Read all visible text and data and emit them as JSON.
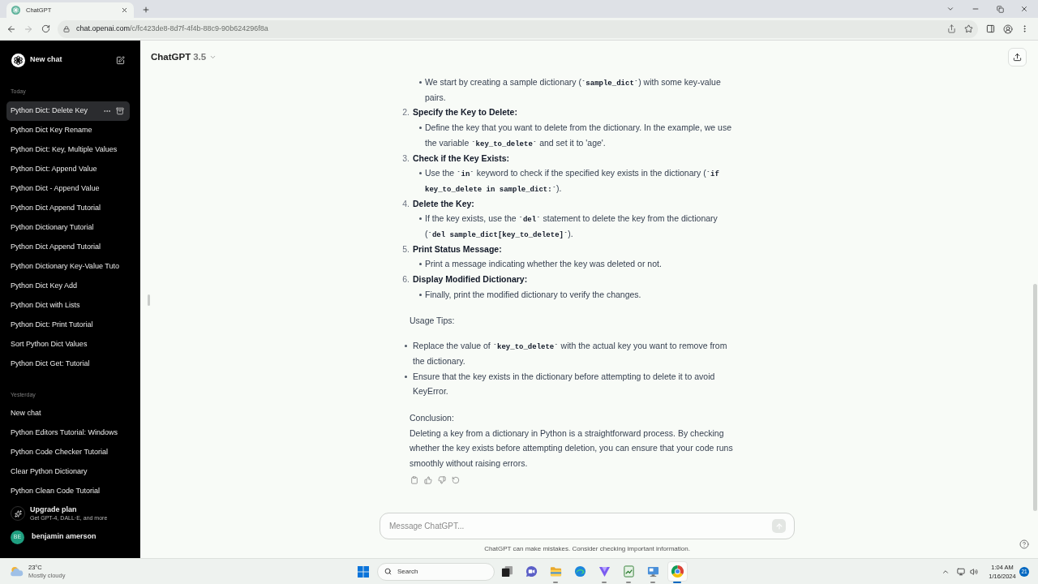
{
  "browser": {
    "tab_title": "ChatGPT",
    "url_host": "chat.openai.com",
    "url_path": "/c/fc423de8-8d7f-4f4b-88c9-90b624296f8a"
  },
  "sidebar": {
    "new_chat": "New chat",
    "groups": [
      {
        "label": "Today",
        "items": [
          {
            "title": "Python Dict: Delete Key",
            "selected": true
          },
          {
            "title": "Python Dict Key Rename",
            "selected": false
          },
          {
            "title": "Python Dict: Key, Multiple Values",
            "selected": false
          },
          {
            "title": "Python Dict: Append Value",
            "selected": false
          },
          {
            "title": "Python Dict - Append Value",
            "selected": false
          },
          {
            "title": "Python Dict Append Tutorial",
            "selected": false
          },
          {
            "title": "Python Dictionary Tutorial",
            "selected": false
          },
          {
            "title": "Python Dict Append Tutorial",
            "selected": false
          },
          {
            "title": "Python Dictionary Key-Value Tuto",
            "selected": false
          },
          {
            "title": "Python Dict Key Add",
            "selected": false
          },
          {
            "title": "Python Dict with Lists",
            "selected": false
          },
          {
            "title": "Python Dict: Print Tutorial",
            "selected": false
          },
          {
            "title": "Sort Python Dict Values",
            "selected": false
          },
          {
            "title": "Python Dict Get: Tutorial",
            "selected": false
          }
        ]
      },
      {
        "label": "Yesterday",
        "items": [
          {
            "title": "New chat",
            "selected": false
          },
          {
            "title": "Python Editors Tutorial: Windows",
            "selected": false
          },
          {
            "title": "Python Code Checker Tutorial",
            "selected": false
          },
          {
            "title": "Clear Python Dictionary",
            "selected": false
          },
          {
            "title": "Python Clean Code Tutorial",
            "selected": false
          }
        ]
      }
    ],
    "upgrade": {
      "title": "Upgrade plan",
      "subtitle": "Get GPT-4, DALL·E, and more"
    },
    "user": {
      "initials": "BE",
      "name": "benjamin amerson"
    }
  },
  "header": {
    "model": "ChatGPT",
    "version": "3.5"
  },
  "message": {
    "steps": [
      {
        "bullets": [
          [
            {
              "kind": "text",
              "text": "We start by creating a sample dictionary ("
            },
            {
              "kind": "code",
              "text": "`sample_dict`"
            },
            {
              "kind": "text",
              "text": ") with some key-value pairs."
            }
          ]
        ]
      },
      {
        "number": "2.",
        "heading": "Specify the Key to Delete:",
        "bullets": [
          [
            {
              "kind": "text",
              "text": "Define the key that you want to delete from the dictionary. In the example, we use the variable "
            },
            {
              "kind": "code",
              "text": "`key_to_delete`"
            },
            {
              "kind": "text",
              "text": " and set it to 'age'."
            }
          ]
        ]
      },
      {
        "number": "3.",
        "heading": "Check if the Key Exists:",
        "bullets": [
          [
            {
              "kind": "text",
              "text": "Use the "
            },
            {
              "kind": "code",
              "text": "`in`"
            },
            {
              "kind": "text",
              "text": " keyword to check if the specified key exists in the dictionary ("
            },
            {
              "kind": "code",
              "text": "`if key_to_delete in sample_dict:`"
            },
            {
              "kind": "text",
              "text": ")."
            }
          ]
        ]
      },
      {
        "number": "4.",
        "heading": "Delete the Key:",
        "bullets": [
          [
            {
              "kind": "text",
              "text": "If the key exists, use the "
            },
            {
              "kind": "code",
              "text": "`del`"
            },
            {
              "kind": "text",
              "text": " statement to delete the key from the dictionary ("
            },
            {
              "kind": "code",
              "text": "`del sample_dict[key_to_delete]`"
            },
            {
              "kind": "text",
              "text": ")."
            }
          ]
        ]
      },
      {
        "number": "5.",
        "heading": "Print Status Message:",
        "bullets": [
          [
            {
              "kind": "text",
              "text": "Print a message indicating whether the key was deleted or not."
            }
          ]
        ]
      },
      {
        "number": "6.",
        "heading": "Display Modified Dictionary:",
        "bullets": [
          [
            {
              "kind": "text",
              "text": "Finally, print the modified dictionary to verify the changes."
            }
          ]
        ]
      }
    ],
    "tips_heading": "Usage Tips:",
    "tips": [
      [
        {
          "kind": "text",
          "text": "Replace the value of "
        },
        {
          "kind": "code",
          "text": "`key_to_delete`"
        },
        {
          "kind": "text",
          "text": " with the actual key you want to remove from the dictionary."
        }
      ],
      [
        {
          "kind": "text",
          "text": "Ensure that the key exists in the dictionary before attempting to delete it to avoid KeyError."
        }
      ]
    ],
    "conclusion_heading": "Conclusion:",
    "conclusion": "Deleting a key from a dictionary in Python is a straightforward process. By checking whether the key exists before attempting deletion, you can ensure that your code runs smoothly without raising errors."
  },
  "composer": {
    "placeholder": "Message ChatGPT...",
    "send_disabled": true,
    "disclaimer": "ChatGPT can make mistakes. Consider checking important information."
  },
  "taskbar": {
    "weather": {
      "temperature": "23°C",
      "condition": "Mostly cloudy"
    },
    "search": "Search",
    "apps": [
      {
        "kind": "task-view",
        "running": false,
        "active": false
      },
      {
        "kind": "chat",
        "running": false,
        "active": false
      },
      {
        "kind": "folder",
        "running": true,
        "active": false
      },
      {
        "kind": "wave-browser",
        "running": false,
        "active": false
      },
      {
        "kind": "funnel",
        "running": true,
        "active": false
      },
      {
        "kind": "chart",
        "running": true,
        "active": false
      },
      {
        "kind": "monitor",
        "running": true,
        "active": false
      },
      {
        "kind": "circle-browser",
        "running": true,
        "active": true
      }
    ],
    "time": "1:04 AM",
    "date": "1/16/2024",
    "notifications": "21"
  }
}
